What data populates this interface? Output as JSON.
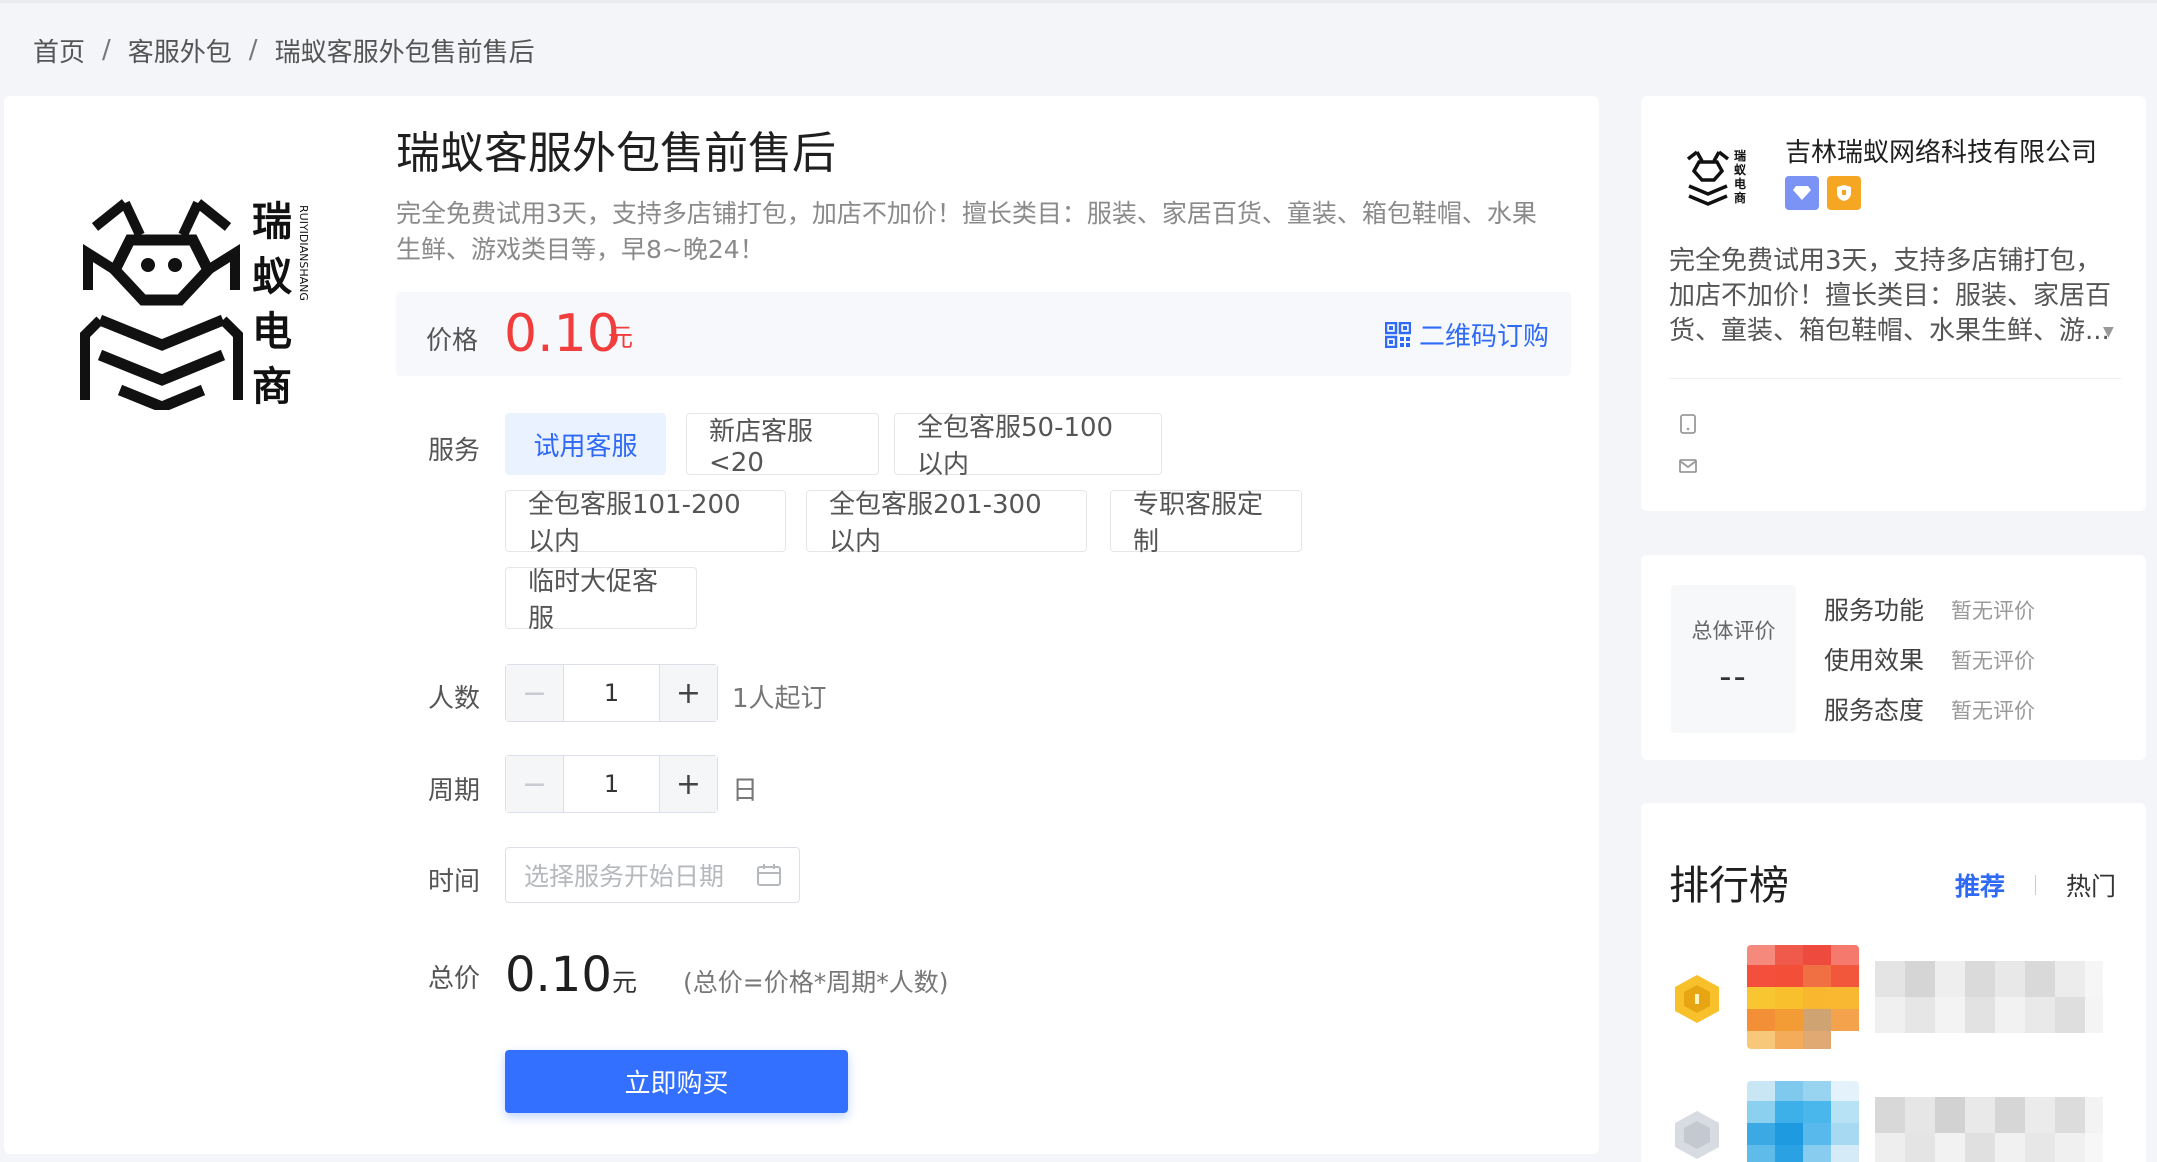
{
  "breadcrumb": {
    "items": [
      "首页",
      "客服外包",
      "瑞蚁客服外包售前售后"
    ],
    "separator": "/"
  },
  "product": {
    "logo_text": "瑞蚁电商",
    "logo_subtext": "RUIYIDIANSHANG",
    "title": "瑞蚁客服外包售前售后",
    "description": "完全免费试用3天，支持多店铺打包，加店不加价！擅长类目：服装、家居百货、童装、箱包鞋帽、水果生鲜、游戏类目等，早8~晚24！",
    "price_label": "价格",
    "price": "0.10",
    "price_unit": "元",
    "qr_order_label": "二维码订购"
  },
  "form": {
    "service_label": "服务",
    "services": [
      {
        "label": "试用客服",
        "selected": true
      },
      {
        "label": "新店客服<20",
        "selected": false
      },
      {
        "label": "全包客服50-100以内",
        "selected": false
      },
      {
        "label": "全包客服101-200以内",
        "selected": false
      },
      {
        "label": "全包客服201-300以内",
        "selected": false
      },
      {
        "label": "专职客服定制",
        "selected": false
      },
      {
        "label": "临时大促客服",
        "selected": false
      }
    ],
    "people_label": "人数",
    "people_value": "1",
    "people_hint": "1人起订",
    "period_label": "周期",
    "period_value": "1",
    "period_unit": "日",
    "time_label": "时间",
    "time_placeholder": "选择服务开始日期",
    "total_label": "总价",
    "total_value": "0.10",
    "total_unit": "元",
    "total_formula": "(总价=价格*周期*人数)",
    "buy_label": "立即购买",
    "minus_symbol": "−",
    "plus_symbol": "+"
  },
  "company": {
    "name": "吉林瑞蚁网络科技有限公司",
    "badges": [
      "diamond-badge",
      "shield-badge"
    ],
    "description": "完全免费试用3天，支持多店铺打包，加店不加价！擅长类目：服装、家居百货、童装、箱包鞋帽、水果生鲜、游..."
  },
  "rating": {
    "overall_label": "总体评价",
    "overall_value": "--",
    "items": [
      {
        "label": "服务功能",
        "value": "暂无评价"
      },
      {
        "label": "使用效果",
        "value": "暂无评价"
      },
      {
        "label": "服务态度",
        "value": "暂无评价"
      }
    ]
  },
  "ranking": {
    "title": "排行榜",
    "tabs": [
      {
        "label": "推荐",
        "active": true
      },
      {
        "label": "热门",
        "active": false
      }
    ]
  },
  "colors": {
    "accent": "#3370ff",
    "price": "#f23d3d",
    "background": "#f3f5f8"
  }
}
